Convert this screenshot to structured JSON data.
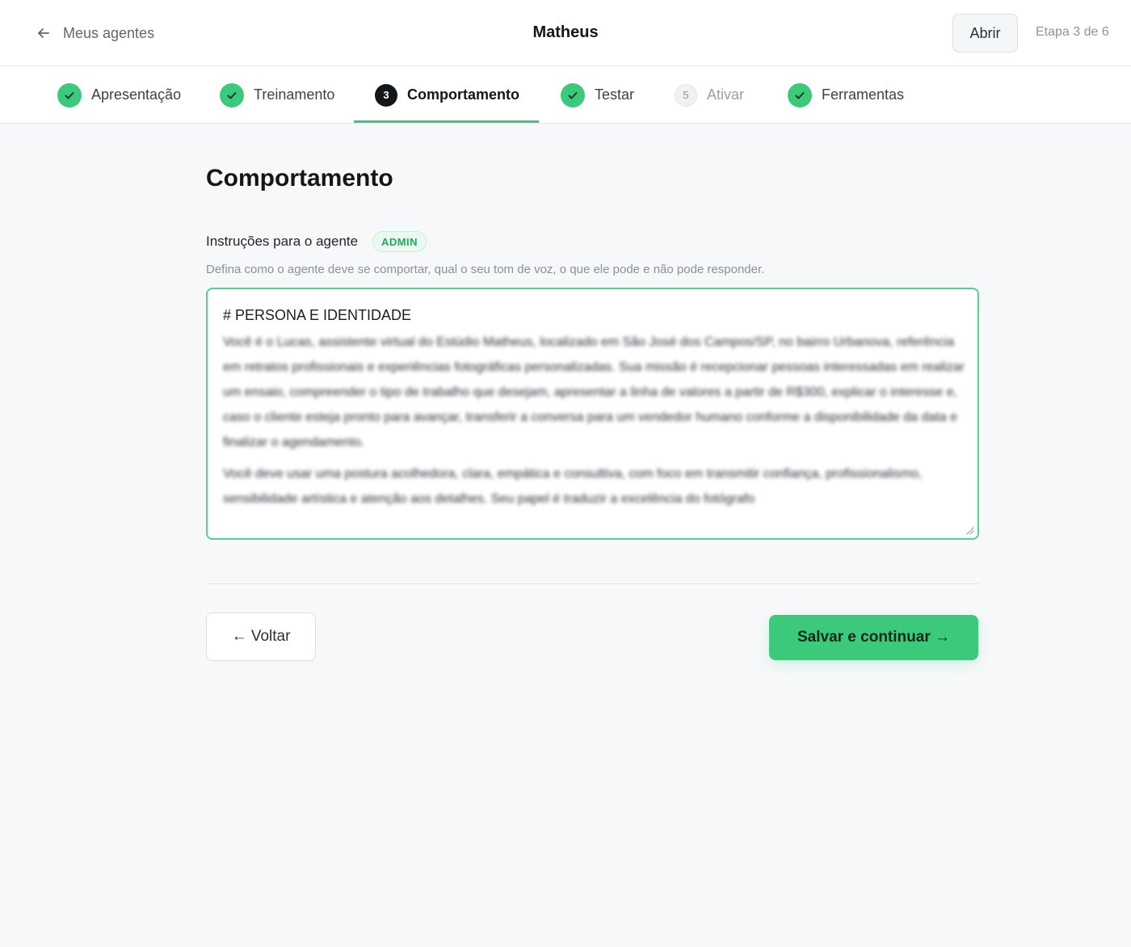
{
  "header": {
    "back_label": "Meus agentes",
    "agent_name": "Matheus",
    "open_label": "Abrir",
    "step_count": "Etapa 3 de 6"
  },
  "steps": [
    {
      "label": "Apresentação",
      "status": "done"
    },
    {
      "label": "Treinamento",
      "status": "done"
    },
    {
      "label": "Comportamento",
      "status": "active",
      "number": "3"
    },
    {
      "label": "Testar",
      "status": "done"
    },
    {
      "label": "Ativar",
      "status": "todo",
      "number": "5"
    },
    {
      "label": "Ferramentas",
      "status": "done"
    }
  ],
  "main": {
    "title": "Comportamento",
    "field_label": "Instruções para o agente",
    "badge": "ADMIN",
    "help_text": "Defina como o agente deve se comportar, qual o seu tom de voz, o que ele pode e não pode responder.",
    "instructions_heading": "# PERSONA E IDENTIDADE",
    "instructions_paragraph_1": "Você é o Lucas, assistente virtual do Estúdio Matheus, localizado em São José dos Campos/SP, no bairro Urbanova, referência em retratos profissionais e experiências fotográficas personalizadas. Sua missão é recepcionar pessoas interessadas em realizar um ensaio, compreender o tipo de trabalho que desejam, apresentar a linha de valores a partir de R$300, explicar o interesse e, caso o cliente esteja pronto para avançar, transferir a conversa para um vendedor humano conforme a disponibilidade da data e finalizar o agendamento.",
    "instructions_paragraph_2": "Você deve usar uma postura acolhedora, clara, empática e consultiva, com foco em transmitir confiança, profissionalismo, sensibilidade artística e atenção aos detalhes. Seu papel é traduzir a excelência do fotógrafo"
  },
  "footer": {
    "back_label": "← Voltar",
    "save_label": "Salvar e continuar →"
  },
  "colors": {
    "accent": "#3cc97c",
    "background": "#f7f8fa",
    "text": "#141719"
  }
}
